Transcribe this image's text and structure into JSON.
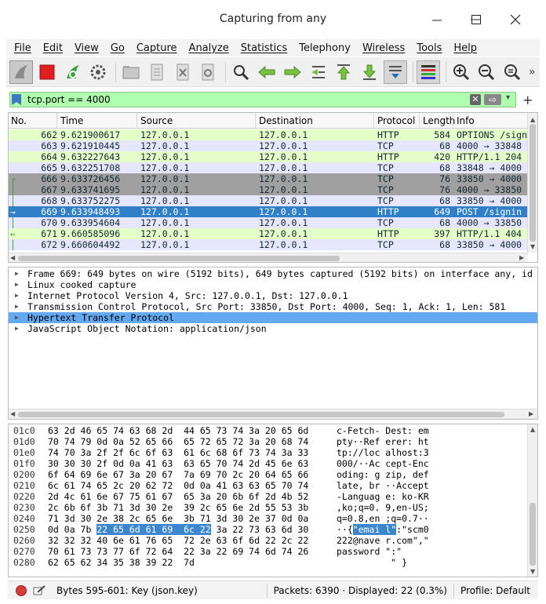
{
  "window": {
    "title": "Capturing from any",
    "min": "—",
    "max": "□",
    "close": "✕"
  },
  "menu": [
    "File",
    "Edit",
    "View",
    "Go",
    "Capture",
    "Analyze",
    "Statistics",
    "Telephony",
    "Wireless",
    "Tools",
    "Help"
  ],
  "toolbar": {
    "more": "»"
  },
  "filter": {
    "value": "tcp.port == 4000",
    "clear": "✕",
    "apply": "⇨",
    "dropdown": "▾",
    "plus": "+"
  },
  "packet_list": {
    "columns": [
      "No.",
      "Time",
      "Source",
      "Destination",
      "Protocol",
      "Length",
      "Info"
    ],
    "rows": [
      {
        "no": "662",
        "time": "9.621900617",
        "src": "127.0.0.1",
        "dst": "127.0.0.1",
        "proto": "HTTP",
        "len": "584",
        "info": "OPTIONS /signin",
        "bg": "#e4ffc7",
        "fg": "#12272e",
        "mark": ""
      },
      {
        "no": "663",
        "time": "9.621910445",
        "src": "127.0.0.1",
        "dst": "127.0.0.1",
        "proto": "TCP",
        "len": "68",
        "info": "4000 → 33848 [A",
        "bg": "#e7e6ff",
        "fg": "#12272e",
        "mark": ""
      },
      {
        "no": "664",
        "time": "9.632227643",
        "src": "127.0.0.1",
        "dst": "127.0.0.1",
        "proto": "HTTP",
        "len": "420",
        "info": "HTTP/1.1 204 No",
        "bg": "#e4ffc7",
        "fg": "#12272e",
        "mark": ""
      },
      {
        "no": "665",
        "time": "9.632251708",
        "src": "127.0.0.1",
        "dst": "127.0.0.1",
        "proto": "TCP",
        "len": "68",
        "info": "33848 → 4000 [A",
        "bg": "#e7e6ff",
        "fg": "#12272e",
        "mark": ""
      },
      {
        "no": "666",
        "time": "9.633726456",
        "src": "127.0.0.1",
        "dst": "127.0.0.1",
        "proto": "TCP",
        "len": "76",
        "info": "33850 → 4000 [S",
        "bg": "#a0a0a0",
        "fg": "#12272e",
        "mark": "┌"
      },
      {
        "no": "667",
        "time": "9.633741695",
        "src": "127.0.0.1",
        "dst": "127.0.0.1",
        "proto": "TCP",
        "len": "76",
        "info": "4000 → 33850 [S",
        "bg": "#a0a0a0",
        "fg": "#12272e",
        "mark": "│"
      },
      {
        "no": "668",
        "time": "9.633752275",
        "src": "127.0.0.1",
        "dst": "127.0.0.1",
        "proto": "TCP",
        "len": "68",
        "info": "33850 → 4000 [A",
        "bg": "#e7e6ff",
        "fg": "#12272e",
        "mark": "│"
      },
      {
        "no": "669",
        "time": "9.633948493",
        "src": "127.0.0.1",
        "dst": "127.0.0.1",
        "proto": "HTTP",
        "len": "649",
        "info": "POST /signin HT",
        "bg": "#2f80c6",
        "fg": "#ffffff",
        "mark": "→"
      },
      {
        "no": "670",
        "time": "9.633954604",
        "src": "127.0.0.1",
        "dst": "127.0.0.1",
        "proto": "TCP",
        "len": "68",
        "info": "4000 → 33850 [A",
        "bg": "#e7e6ff",
        "fg": "#12272e",
        "mark": "│"
      },
      {
        "no": "671",
        "time": "9.660585096",
        "src": "127.0.0.1",
        "dst": "127.0.0.1",
        "proto": "HTTP",
        "len": "397",
        "info": "HTTP/1.1 404 No",
        "bg": "#e4ffc7",
        "fg": "#12272e",
        "mark": "←"
      },
      {
        "no": "672",
        "time": "9.660604492",
        "src": "127.0.0.1",
        "dst": "127.0.0.1",
        "proto": "TCP",
        "len": "68",
        "info": "33850 → 4000 [A",
        "bg": "#e7e6ff",
        "fg": "#12272e",
        "mark": "│"
      }
    ]
  },
  "details": [
    {
      "text": "Frame 669: 649 bytes on wire (5192 bits), 649 bytes captured (5192 bits) on interface any, id 0",
      "selected": false
    },
    {
      "text": "Linux cooked capture",
      "selected": false
    },
    {
      "text": "Internet Protocol Version 4, Src: 127.0.0.1, Dst: 127.0.0.1",
      "selected": false
    },
    {
      "text": "Transmission Control Protocol, Src Port: 33850, Dst Port: 4000, Seq: 1, Ack: 1, Len: 581",
      "selected": false
    },
    {
      "text": "Hypertext Transfer Protocol",
      "selected": true
    },
    {
      "text": "JavaScript Object Notation: application/json",
      "selected": false
    }
  ],
  "bytes": [
    {
      "off": "01c0",
      "hex": "63 2d 46 65 74 63 68 2d  44 65 73 74 3a 20 65 6d",
      "asc": "c-Fetch- Dest: em"
    },
    {
      "off": "01d0",
      "hex": "70 74 79 0d 0a 52 65 66  65 72 65 72 3a 20 68 74",
      "asc": "pty··Ref erer: ht"
    },
    {
      "off": "01e0",
      "hex": "74 70 3a 2f 2f 6c 6f 63  61 6c 68 6f 73 74 3a 33",
      "asc": "tp://loc alhost:3"
    },
    {
      "off": "01f0",
      "hex": "30 30 30 2f 0d 0a 41 63  63 65 70 74 2d 45 6e 63",
      "asc": "000/··Ac cept-Enc"
    },
    {
      "off": "0200",
      "hex": "6f 64 69 6e 67 3a 20 67  7a 69 70 2c 20 64 65 66",
      "asc": "oding: g zip, def"
    },
    {
      "off": "0210",
      "hex": "6c 61 74 65 2c 20 62 72  0d 0a 41 63 63 65 70 74",
      "asc": "late, br ··Accept"
    },
    {
      "off": "0220",
      "hex": "2d 4c 61 6e 67 75 61 67  65 3a 20 6b 6f 2d 4b 52",
      "asc": "-Languag e: ko-KR"
    },
    {
      "off": "0230",
      "hex": "2c 6b 6f 3b 71 3d 30 2e  39 2c 65 6e 2d 55 53 3b",
      "asc": ",ko;q=0. 9,en-US;"
    },
    {
      "off": "0240",
      "hex": "71 3d 30 2e 38 2c 65 6e  3b 71 3d 30 2e 37 0d 0a",
      "asc": "q=0.8,en ;q=0.7··"
    },
    {
      "off": "0250",
      "hex_pre": "0d 0a 7b ",
      "hex_hl": "22 65 6d 61 69  6c 22",
      "hex_post": " 3a 22 73 63 6d 30",
      "asc_pre": "··{",
      "asc_hl": "\"emai l\"",
      "asc_post": ":\"scm0"
    },
    {
      "off": "0260",
      "hex": "32 32 32 40 6e 61 76 65  72 2e 63 6f 6d 22 2c 22",
      "asc": "222@nave r.com\",\""
    },
    {
      "off": "0270",
      "hex": "70 61 73 73 77 6f 72 64  22 3a 22 69 74 6d 74 26",
      "asc": "password \":\""
    },
    {
      "off": "0280",
      "hex": "62 65 62 34 35 38 39 22  7d",
      "asc": "          \" }"
    }
  ],
  "status": {
    "field": "Bytes 595-601: Key (json.key)",
    "packets": "Packets: 6390 · Displayed: 22 (0.3%)",
    "profile": "Profile: Default"
  },
  "colors": {
    "filter_bg": "#afffaf",
    "selection": "#2f80c6",
    "http_row": "#e4ffc7",
    "tcp_row": "#e7e6ff",
    "syn_row": "#a0a0a0"
  }
}
